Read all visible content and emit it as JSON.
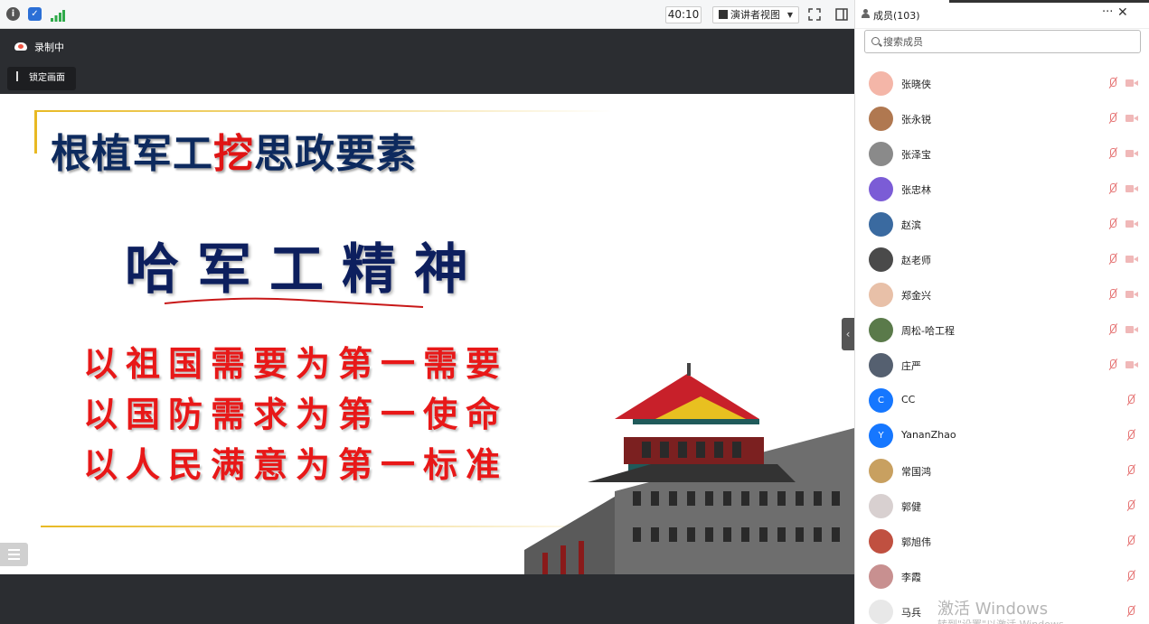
{
  "topbar": {
    "timer": "40:10",
    "view_mode": "演讲者视图"
  },
  "stage": {
    "recording_label": "录制中",
    "lock_label": "锁定画面"
  },
  "slide": {
    "title_prefix": "根植军工",
    "title_highlight": "挖",
    "title_suffix": "思政要素",
    "subtitle": "哈军工精神",
    "lines": [
      "以祖国需要为第一需要",
      "以国防需求为第一使命",
      "以人民满意为第一标准"
    ]
  },
  "panel": {
    "title": "成员(103)",
    "search_placeholder": "搜索成员",
    "members": [
      {
        "name": "张晓侠",
        "avatar": "",
        "color": "#f4b6a8",
        "cam": true
      },
      {
        "name": "张永锐",
        "avatar": "",
        "color": "#b07850",
        "cam": true
      },
      {
        "name": "张泽宝",
        "avatar": "",
        "color": "#8a8a8a",
        "cam": true
      },
      {
        "name": "张忠林",
        "avatar": "",
        "color": "#7b5cd6",
        "cam": true
      },
      {
        "name": "赵滨",
        "avatar": "",
        "color": "#3a6aa0",
        "cam": true
      },
      {
        "name": "赵老师",
        "avatar": "",
        "color": "#4a4a4a",
        "cam": true
      },
      {
        "name": "郑金兴",
        "avatar": "",
        "color": "#e8c0a8",
        "cam": true
      },
      {
        "name": "周松-哈工程",
        "avatar": "",
        "color": "#5a7a4a",
        "cam": true
      },
      {
        "name": "庄严",
        "avatar": "",
        "color": "#556070",
        "cam": true
      },
      {
        "name": "CC",
        "avatar": "C",
        "color": "#1677ff",
        "cam": false
      },
      {
        "name": "YananZhao",
        "avatar": "Y",
        "color": "#1677ff",
        "cam": false
      },
      {
        "name": "常国鸿",
        "avatar": "",
        "color": "#c8a060",
        "cam": false
      },
      {
        "name": "郭健",
        "avatar": "",
        "color": "#d8d0d0",
        "cam": false
      },
      {
        "name": "郭旭伟",
        "avatar": "",
        "color": "#c05040",
        "cam": false
      },
      {
        "name": "李霞",
        "avatar": "",
        "color": "#c89090",
        "cam": false
      },
      {
        "name": "马兵",
        "avatar": "",
        "color": "#e8e8e8",
        "cam": false
      }
    ]
  },
  "watermark": {
    "line1": "激活 Windows",
    "line2": "转到\"设置\"以激活 Windows。"
  },
  "colors": {
    "accent": "#1677ff",
    "slide_title": "#0d2a5e",
    "slide_red": "#e81818",
    "gold_rule": "#e8b923"
  }
}
